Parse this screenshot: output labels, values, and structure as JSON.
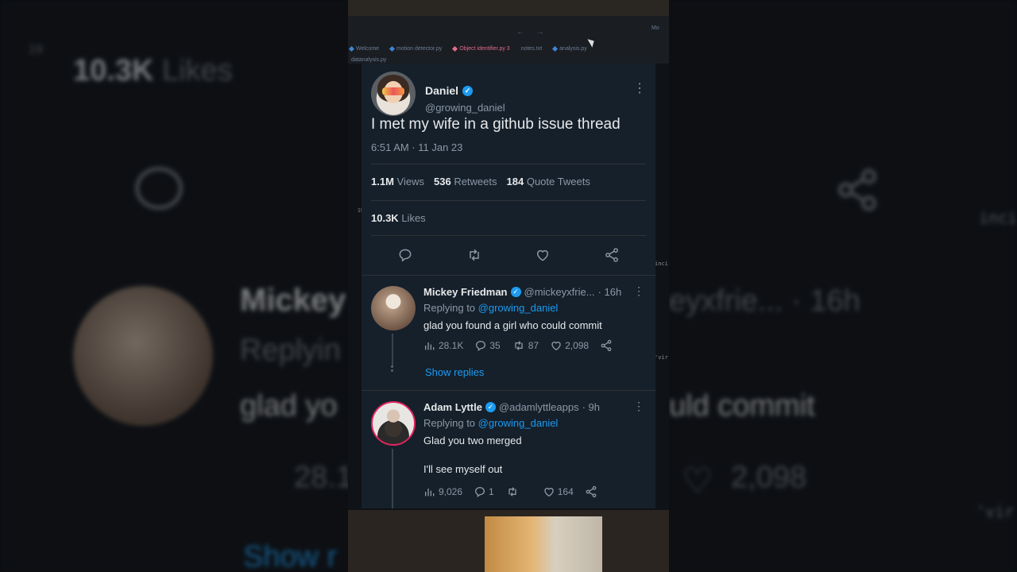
{
  "background": {
    "likes_count": "10.3K",
    "likes_label": "Likes",
    "name": "Mickey",
    "replying": "Replyin",
    "text": "glad yo",
    "right_handle": "eyxfrie... · 16h",
    "right_text": "uld commit",
    "right_likes": "2,098",
    "views": "28.1",
    "show": "Show r",
    "code_right": "inci",
    "code_right2": "'vir",
    "line_num": "19"
  },
  "editor": {
    "tabs": [
      {
        "label": "Welcome"
      },
      {
        "label": "motion detector.py"
      },
      {
        "label": "Object identifier.py 3"
      },
      {
        "label": "notes.txt"
      },
      {
        "label": "analysis.py"
      }
    ],
    "path": "datanalysis.py",
    "search": "Mo",
    "line_num": "19",
    "side_code": "inci",
    "side_code2": "'vir"
  },
  "tweet": {
    "author_name": "Daniel",
    "author_handle": "@growing_daniel",
    "text": "I met my wife in a github issue thread",
    "timestamp": "6:51 AM · 11 Jan 23",
    "views_count": "1.1M",
    "views_label": "Views",
    "retweets_count": "536",
    "retweets_label": "Retweets",
    "quotes_count": "184",
    "quotes_label": "Quote Tweets",
    "likes_count": "10.3K",
    "likes_label": "Likes"
  },
  "replies": [
    {
      "name": "Mickey Friedman",
      "handle": "@mickeyxfrie...",
      "time": "· 16h",
      "replying_prefix": "Replying to",
      "replying_to": "@growing_daniel",
      "text": "glad you found a girl who could commit",
      "views": "28.1K",
      "comments": "35",
      "retweets": "87",
      "likes": "2,098",
      "show_replies": "Show replies"
    },
    {
      "name": "Adam Lyttle",
      "handle": "@adamlyttleapps",
      "time": "· 9h",
      "replying_prefix": "Replying to",
      "replying_to": "@growing_daniel",
      "text": "Glad you two merged",
      "text2": "I'll see myself out",
      "views": "9,026",
      "comments": "1",
      "retweets": "",
      "likes": "164"
    }
  ],
  "colors": {
    "card_bg": "#15202b",
    "accent": "#1d9bf0",
    "muted": "#8b98a5",
    "text": "#e7e9ea"
  }
}
